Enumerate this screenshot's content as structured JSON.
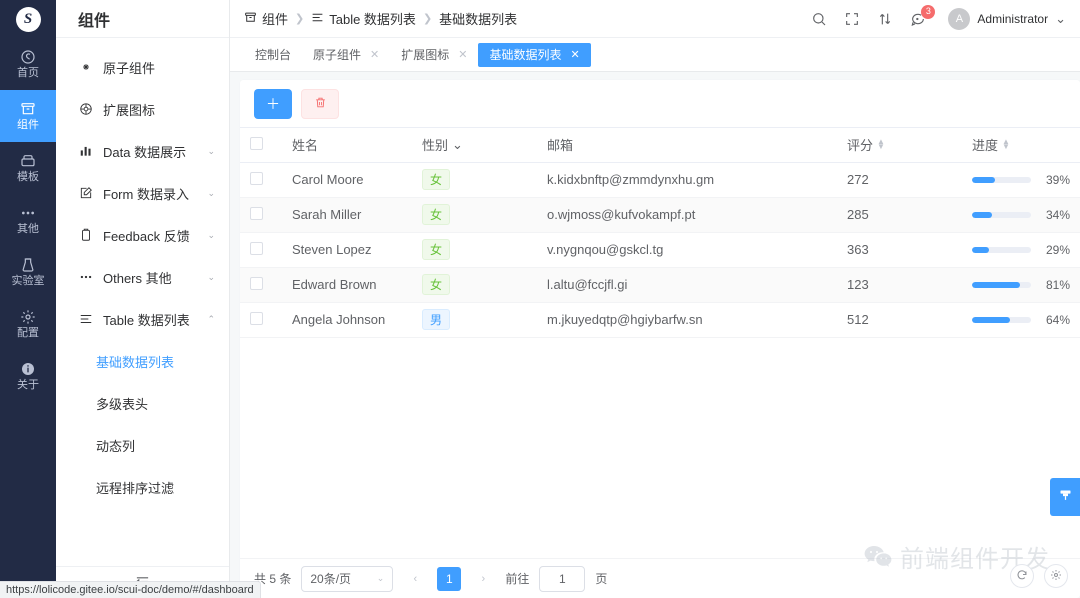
{
  "rail": {
    "logo_glyph": "S",
    "items": [
      {
        "label": "首页",
        "icon": "home-icon",
        "active": false
      },
      {
        "label": "组件",
        "icon": "component-icon",
        "active": true
      },
      {
        "label": "模板",
        "icon": "template-icon",
        "active": false
      },
      {
        "label": "其他",
        "icon": "dots-icon",
        "active": false
      },
      {
        "label": "实验室",
        "icon": "lab-icon",
        "active": false
      },
      {
        "label": "配置",
        "icon": "gear-icon",
        "active": false
      },
      {
        "label": "关于",
        "icon": "info-icon",
        "active": false
      }
    ]
  },
  "sidebar": {
    "title": "组件",
    "menu": [
      {
        "label": "原子组件",
        "icon": "atom-icon",
        "arrow": ""
      },
      {
        "label": "扩展图标",
        "icon": "extension-icon",
        "arrow": ""
      },
      {
        "label": "Data 数据展示",
        "icon": "bar-chart-icon",
        "arrow": "⌄"
      },
      {
        "label": "Form 数据录入",
        "icon": "edit-square-icon",
        "arrow": "⌄"
      },
      {
        "label": "Feedback 反馈",
        "icon": "feedback-icon",
        "arrow": "⌄"
      },
      {
        "label": "Others 其他",
        "icon": "dots-icon",
        "arrow": "⌄"
      },
      {
        "label": "Table 数据列表",
        "icon": "table-icon",
        "arrow": "⌃"
      }
    ],
    "submenu": [
      {
        "label": "基础数据列表",
        "active": true
      },
      {
        "label": "多级表头",
        "active": false
      },
      {
        "label": "动态列",
        "active": false
      },
      {
        "label": "远程排序过滤",
        "active": false
      }
    ],
    "collapse_icon": "collapse-menu-icon"
  },
  "header": {
    "breadcrumb": [
      "组件",
      "Table 数据列表",
      "基础数据列表"
    ],
    "breadcrumb_separator": "❯",
    "icons": [
      {
        "name": "search-icon"
      },
      {
        "name": "fullscreen-icon"
      },
      {
        "name": "sort-arrows-icon"
      },
      {
        "name": "message-icon",
        "badge": "3"
      }
    ],
    "user": {
      "avatar_letter": "A",
      "name": "Administrator",
      "caret": "⌄"
    }
  },
  "tabs": [
    {
      "label": "控制台",
      "closable": false,
      "active": false
    },
    {
      "label": "原子组件",
      "closable": true,
      "active": false
    },
    {
      "label": "扩展图标",
      "closable": true,
      "active": false
    },
    {
      "label": "基础数据列表",
      "closable": true,
      "active": true
    }
  ],
  "toolbar": {
    "add_label": "＋",
    "delete_icon": "trash-icon"
  },
  "table": {
    "columns": [
      {
        "label": "",
        "type": "checkbox"
      },
      {
        "label": "姓名",
        "sortable": false,
        "filter": false
      },
      {
        "label": "性别",
        "sortable": false,
        "filter": true
      },
      {
        "label": "邮箱",
        "sortable": false,
        "filter": false
      },
      {
        "label": "评分",
        "sortable": true,
        "filter": false
      },
      {
        "label": "进度",
        "sortable": true,
        "filter": false
      }
    ],
    "rows": [
      {
        "name": "Carol Moore",
        "gender": "女",
        "gender_type": "f",
        "email": "k.kidxbnftp@zmmdynxhu.gm",
        "score": "272",
        "progress": 39,
        "progress_label": "39%"
      },
      {
        "name": "Sarah Miller",
        "gender": "女",
        "gender_type": "f",
        "email": "o.wjmoss@kufvokampf.pt",
        "score": "285",
        "progress": 34,
        "progress_label": "34%"
      },
      {
        "name": "Steven Lopez",
        "gender": "女",
        "gender_type": "f",
        "email": "v.nygnqou@gskcl.tg",
        "score": "363",
        "progress": 29,
        "progress_label": "29%"
      },
      {
        "name": "Edward Brown",
        "gender": "女",
        "gender_type": "f",
        "email": "l.altu@fccjfl.gi",
        "score": "123",
        "progress": 81,
        "progress_label": "81%"
      },
      {
        "name": "Angela Johnson",
        "gender": "男",
        "gender_type": "m",
        "email": "m.jkuyedqtp@hgiybarfw.sn",
        "score": "512",
        "progress": 64,
        "progress_label": "64%"
      }
    ]
  },
  "pagination": {
    "total_text": "共 5 条",
    "page_size": "20条/页",
    "prev_icon": "‹",
    "next_icon": "›",
    "current_page": "1",
    "jump_prefix": "前往",
    "jump_value": "1",
    "jump_suffix": "页"
  },
  "floating": {
    "theme_button_icon": "brush-icon",
    "refresh_icon": "refresh-icon",
    "settings_icon": "gear-icon"
  },
  "watermark": {
    "text": "前端组件开发",
    "logo": "wechat-icon"
  },
  "status_bar": {
    "url": "https://lolicode.gitee.io/scui-doc/demo/#/dashboard"
  },
  "colors": {
    "accent": "#409eff",
    "rail_bg": "#222b45",
    "danger": "#f56c6c",
    "success": "#67c23a"
  }
}
